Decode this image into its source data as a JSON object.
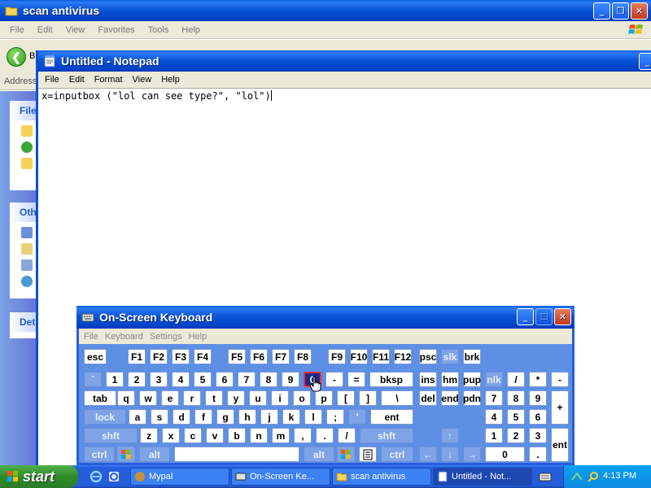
{
  "explorer": {
    "title": "scan antivirus",
    "menu": [
      "File",
      "Edit",
      "View",
      "Favorites",
      "Tools",
      "Help"
    ],
    "back_label": "B",
    "address_label": "Address",
    "taskpane_heads": [
      "File",
      "Oth",
      "Det"
    ]
  },
  "notepad": {
    "title": "Untitled - Notepad",
    "menu": [
      "File",
      "Edit",
      "Format",
      "View",
      "Help"
    ],
    "content": "x=inputbox (\"lol can see type?\", \"lol\")"
  },
  "osk": {
    "title": "On-Screen Keyboard",
    "menu": [
      "File",
      "Keyboard",
      "Settings",
      "Help"
    ],
    "pressed_key": "0"
  },
  "taskbar": {
    "start_label": "start",
    "tasks": [
      {
        "label": "Mypal",
        "active": false
      },
      {
        "label": "On-Screen Ke...",
        "active": false
      },
      {
        "label": "scan antivirus",
        "active": false
      },
      {
        "label": "Untitled - Not...",
        "active": true
      }
    ],
    "clock": "4:13 PM"
  },
  "colors": {
    "title_blue": "#0a56d8",
    "osk_bg": "#5d8fe4",
    "taskbar": "#245edb",
    "start_green": "#2f8a2b",
    "pressed_key": "#1c2a8a"
  }
}
